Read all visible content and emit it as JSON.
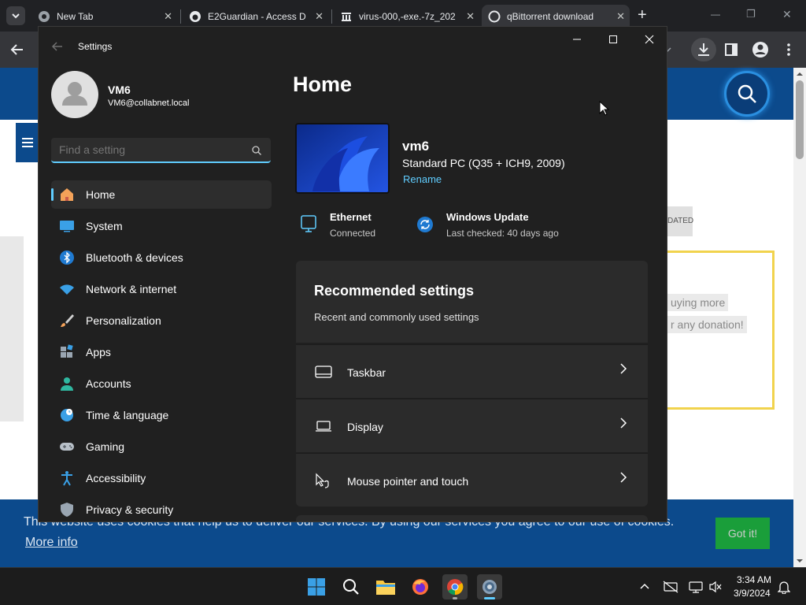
{
  "chrome": {
    "tabs": [
      {
        "title": "New Tab",
        "close": "✕"
      },
      {
        "title": "E2Guardian - Access D",
        "close": "✕"
      },
      {
        "title": "virus-000,-exe.-7z_202",
        "close": "✕"
      },
      {
        "title": "qBittorrent download",
        "close": "✕"
      }
    ],
    "new_tab": "+",
    "window_controls": {
      "minimize": "—",
      "restore": "❐",
      "close": "✕"
    }
  },
  "webpage": {
    "status_fragment": "DATED",
    "donation_text_1": "uying more",
    "donation_text_2": "r any donation!",
    "cookie_text": "This website uses cookies that help us to deliver our services. By using our services you agree to our use of cookies.",
    "more_info": "More info",
    "got_it": "Got it!"
  },
  "settings": {
    "title": "Settings",
    "user": {
      "name": "VM6",
      "email": "VM6@collabnet.local"
    },
    "search": {
      "placeholder": "Find a setting"
    },
    "nav": [
      {
        "label": "Home"
      },
      {
        "label": "System"
      },
      {
        "label": "Bluetooth & devices"
      },
      {
        "label": "Network & internet"
      },
      {
        "label": "Personalization"
      },
      {
        "label": "Apps"
      },
      {
        "label": "Accounts"
      },
      {
        "label": "Time & language"
      },
      {
        "label": "Gaming"
      },
      {
        "label": "Accessibility"
      },
      {
        "label": "Privacy & security"
      }
    ],
    "page_title": "Home",
    "device": {
      "name": "vm6",
      "model": "Standard PC (Q35 + ICH9, 2009)",
      "rename": "Rename"
    },
    "status": {
      "ethernet": {
        "title": "Ethernet",
        "sub": "Connected"
      },
      "update": {
        "title": "Windows Update",
        "sub": "Last checked: 40 days ago"
      }
    },
    "recommended": {
      "title": "Recommended settings",
      "subtitle": "Recent and commonly used settings",
      "items": [
        {
          "label": "Taskbar"
        },
        {
          "label": "Display"
        },
        {
          "label": "Mouse pointer and touch"
        }
      ]
    },
    "accent_color": "#60cdff"
  },
  "taskbar": {
    "time": "3:34 AM",
    "date": "3/9/2024"
  }
}
